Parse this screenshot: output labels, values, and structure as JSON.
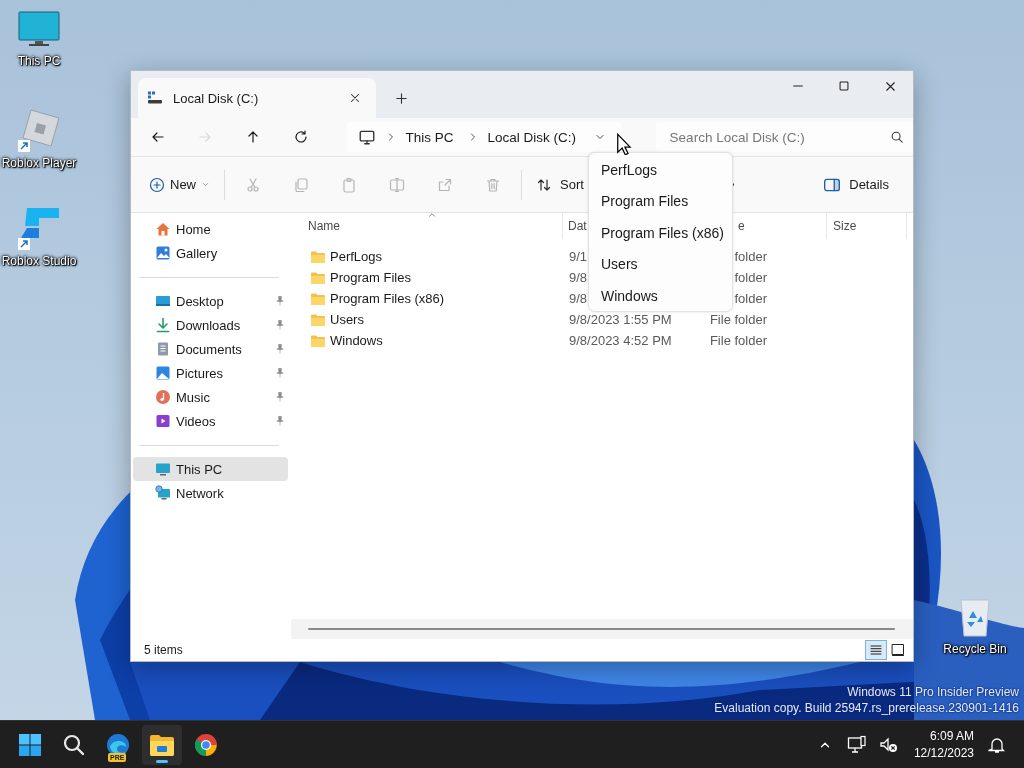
{
  "desktop": {
    "icons": [
      {
        "label": "This PC",
        "kind": "pc",
        "shortcut": false
      },
      {
        "label": "Roblox Player",
        "kind": "player",
        "shortcut": true
      },
      {
        "label": "Roblox Studio",
        "kind": "studio",
        "shortcut": true
      }
    ],
    "recycle_bin": {
      "label": "Recycle Bin"
    },
    "evaluation_notice": [
      "Windows 11 Pro Insider Preview",
      "Evaluation copy. Build 25947.rs_prerelease.230901-1416"
    ]
  },
  "window": {
    "tabs": [
      {
        "title": "Local Disk (C:)",
        "selected": true
      }
    ],
    "nav": [
      {
        "kind": "back",
        "disabled": false
      },
      {
        "kind": "forward",
        "disabled": true
      },
      {
        "kind": "up",
        "disabled": false
      },
      {
        "kind": "refresh",
        "disabled": false
      }
    ],
    "address_bar": {
      "crumbs": [
        "This PC",
        "Local Disk (C:)"
      ]
    },
    "search": {
      "placeholder": "Search Local Disk (C:)"
    },
    "toolbar": {
      "items": [
        {
          "kind": "new",
          "label": "New",
          "disabled": false
        },
        {
          "kind": "cut",
          "disabled": true
        },
        {
          "kind": "copy",
          "disabled": true
        },
        {
          "kind": "paste",
          "disabled": true
        },
        {
          "kind": "rename",
          "disabled": true
        },
        {
          "kind": "share",
          "disabled": true
        },
        {
          "kind": "delete",
          "disabled": true
        },
        {
          "kind": "sort",
          "label": "Sort",
          "disabled": false
        },
        {
          "kind": "more",
          "disabled": false
        }
      ],
      "details": {
        "label": "Details"
      }
    },
    "sidebar": {
      "groups": [
        {
          "items": [
            {
              "label": "Home",
              "kind": "home",
              "pinned": false,
              "selected": false
            },
            {
              "label": "Gallery",
              "kind": "gallery",
              "pinned": false,
              "selected": false
            }
          ]
        },
        {
          "items": [
            {
              "label": "Desktop",
              "kind": "desktop",
              "pinned": true,
              "selected": false
            },
            {
              "label": "Downloads",
              "kind": "downloads",
              "pinned": true,
              "selected": false
            },
            {
              "label": "Documents",
              "kind": "documents",
              "pinned": true,
              "selected": false
            },
            {
              "label": "Pictures",
              "kind": "pictures",
              "pinned": true,
              "selected": false
            },
            {
              "label": "Music",
              "kind": "music",
              "pinned": true,
              "selected": false
            },
            {
              "label": "Videos",
              "kind": "videos",
              "pinned": true,
              "selected": false
            }
          ]
        },
        {
          "items": [
            {
              "label": "This PC",
              "kind": "thispc",
              "pinned": false,
              "selected": true
            },
            {
              "label": "Network",
              "kind": "network",
              "pinned": false,
              "selected": false
            }
          ]
        }
      ]
    },
    "columns": [
      {
        "label": "Name",
        "sorted": true
      },
      {
        "label": "Dat",
        "sorted": false
      },
      {
        "label": "e",
        "sorted": false
      },
      {
        "label": "Size",
        "sorted": false
      }
    ],
    "rows": [
      {
        "name": "PerfLogs",
        "date": "9/1",
        "type": "folder"
      },
      {
        "name": "Program Files",
        "date": "9/8",
        "type": "folder"
      },
      {
        "name": "Program Files (x86)",
        "date": "9/8",
        "type": "folder"
      },
      {
        "name": "Users",
        "date": "9/8/2023 1:55 PM",
        "type": "File folder"
      },
      {
        "name": "Windows",
        "date": "9/8/2023 4:52 PM",
        "type": "File folder"
      }
    ],
    "dropdown": {
      "items": [
        "PerfLogs",
        "Program Files",
        "Program Files (x86)",
        "Users",
        "Windows"
      ]
    },
    "status": {
      "count": "5 items",
      "views": [
        {
          "kind": "details",
          "selected": true
        },
        {
          "kind": "tiles",
          "selected": false
        }
      ]
    }
  },
  "taskbar": {
    "apps": [
      {
        "kind": "start",
        "active": false
      },
      {
        "kind": "search",
        "active": false
      },
      {
        "kind": "edge",
        "badge": "PRE",
        "active": false
      },
      {
        "kind": "explorer",
        "active": true
      },
      {
        "kind": "chrome",
        "active": false
      }
    ],
    "clock": {
      "time": "6:09 AM",
      "date": "12/12/2023"
    }
  }
}
